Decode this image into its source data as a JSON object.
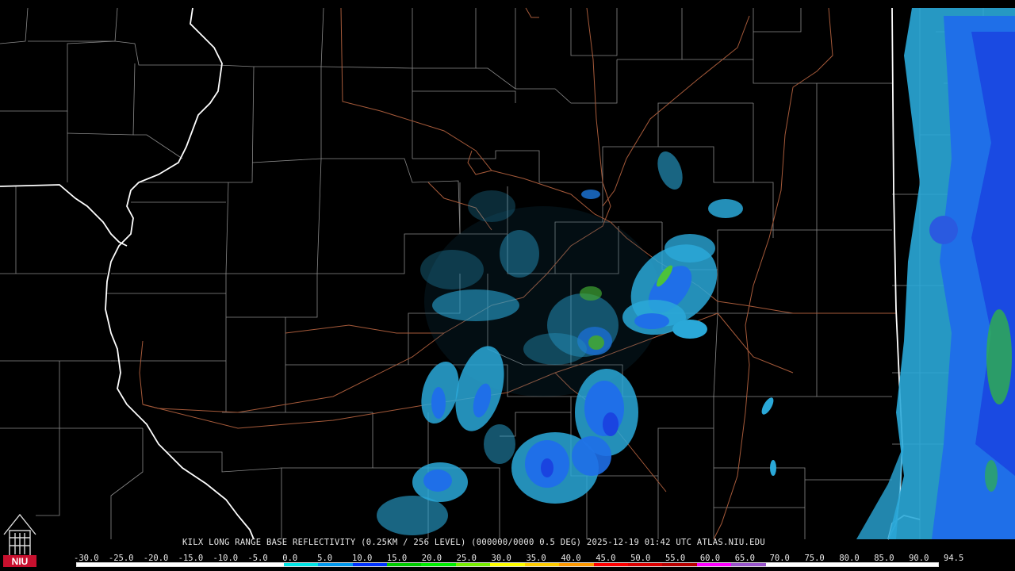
{
  "title": "KILX LONG RANGE BASE REFLECTIVITY (0.25KM / 256 LEVEL) (000000/0000 0.5 DEG) 2025-12-19 01:42 UTC  ATLAS.NIU.EDU",
  "logo_text": "NIU",
  "scale": {
    "labels": [
      "-30.0",
      "-25.0",
      "-20.0",
      "-15.0",
      "-10.0",
      "-5.0",
      "0.0",
      "5.0",
      "10.0",
      "15.0",
      "20.0",
      "25.0",
      "30.0",
      "35.0",
      "40.0",
      "45.0",
      "50.0",
      "55.0",
      "60.0",
      "65.0",
      "70.0",
      "75.0",
      "80.0",
      "85.0",
      "90.0",
      "94.5"
    ],
    "colors": [
      "#ffffff",
      "#ffffff",
      "#ffffff",
      "#ffffff",
      "#ffffff",
      "#ffffff",
      "#00e5e5",
      "#0099ee",
      "#0033ff",
      "#00cc00",
      "#00ee00",
      "#77ee00",
      "#ffff00",
      "#ffcc00",
      "#ff9900",
      "#ff0000",
      "#dd0000",
      "#bb0000",
      "#ff00ff",
      "#9955cc",
      "#ffffff",
      "#ffffff",
      "#ffffff",
      "#ffffff",
      "#ffffff"
    ]
  },
  "map_colors": {
    "county_lines": "#8a8a8a",
    "state_lines": "#ffffff",
    "highways": "#a65a3a",
    "echo_light": "#33c8e8",
    "echo_mid": "#1a6ef0",
    "echo_heavy": "#22b022"
  }
}
